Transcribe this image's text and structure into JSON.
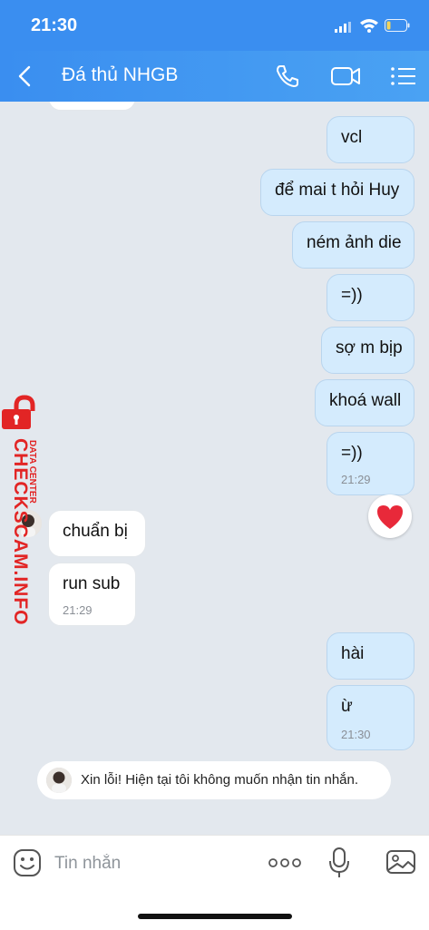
{
  "status_bar": {
    "time": "21:30"
  },
  "header": {
    "title": "Đá thủ NHGB"
  },
  "messages": [
    {
      "text": "vcl",
      "direction": "out"
    },
    {
      "text": "để mai t hỏi Huy",
      "direction": "out"
    },
    {
      "text": "ném ảnh die",
      "direction": "out"
    },
    {
      "text": "=))",
      "direction": "out"
    },
    {
      "text": "sợ m bịp",
      "direction": "out"
    },
    {
      "text": "khoá wall",
      "direction": "out"
    },
    {
      "text": "=))",
      "direction": "out",
      "time": "21:29",
      "reaction": "heart"
    },
    {
      "text": "chuẩn bị",
      "direction": "in"
    },
    {
      "text": "run sub",
      "direction": "in",
      "time": "21:29"
    },
    {
      "text": "hài",
      "direction": "out"
    },
    {
      "text": "ừ",
      "direction": "out",
      "time": "21:30"
    }
  ],
  "notice": {
    "text": "Xin lỗi! Hiện tại tôi không muốn nhận tin nhắn."
  },
  "watermark": {
    "main": "CHECKSCAM.INFO",
    "sub": "DATA CENTER"
  },
  "input": {
    "placeholder": "Tin nhắn"
  },
  "colors": {
    "header": "#3a8ef0",
    "outgoing_bubble": "#d4ebfd",
    "incoming_bubble": "#ffffff",
    "background": "#e3e8ee",
    "watermark": "#e22525"
  }
}
